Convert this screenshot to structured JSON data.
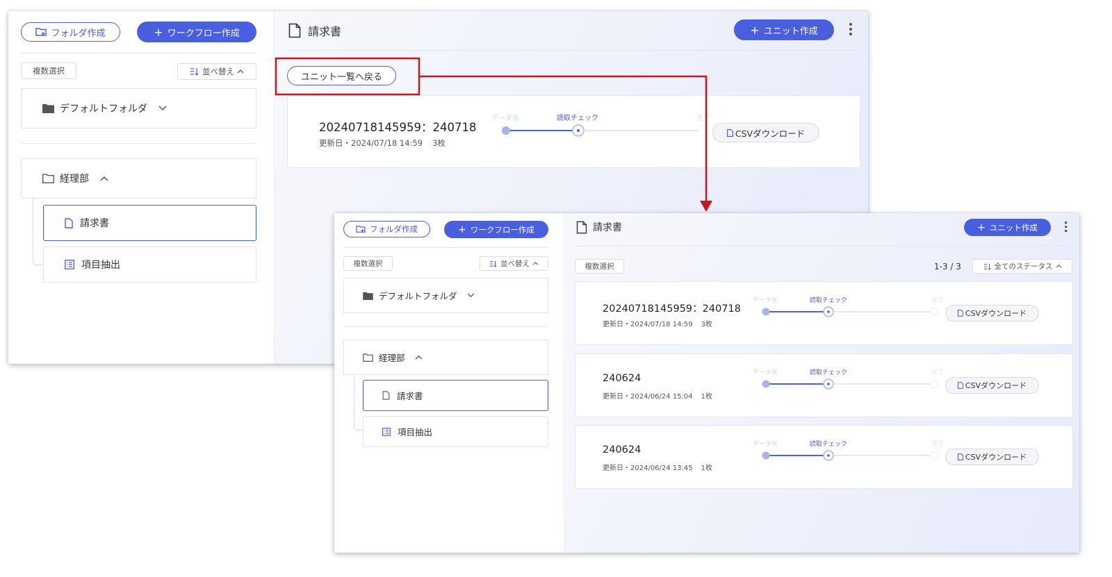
{
  "sidebar": {
    "folder_create": "フォルダ作成",
    "workflow_create": "ワークフロー作成",
    "multi_select": "複数選択",
    "sort": "並べ替え",
    "default_folder": "デフォルトフォルダ",
    "dept_folder": "経理部",
    "items": [
      "請求書",
      "項目抽出"
    ]
  },
  "main": {
    "title": "請求書",
    "unit_create": "ユニット作成",
    "back_button": "ユニット一覧へ戻る",
    "multi_select": "複数選択",
    "pagination": "1-3 / 3",
    "status_filter": "全てのステータス",
    "steps": [
      "データ化",
      "読取チェック",
      "完了"
    ],
    "csv_download": "CSVダウンロード"
  },
  "detail_unit": {
    "name": "20240718145959：240718",
    "updated": "更新日・2024/07/18 14:59",
    "pages": "3枚"
  },
  "units": [
    {
      "name": "20240718145959：240718",
      "updated": "更新日・2024/07/18 14:59",
      "pages": "3枚"
    },
    {
      "name": "240624",
      "updated": "更新日・2024/06/24 15:04",
      "pages": "1枚"
    },
    {
      "name": "240624",
      "updated": "更新日・2024/06/24 13:45",
      "pages": "1枚"
    }
  ],
  "colors": {
    "accent": "#4a5ee0",
    "annotation": "#c8161d"
  }
}
